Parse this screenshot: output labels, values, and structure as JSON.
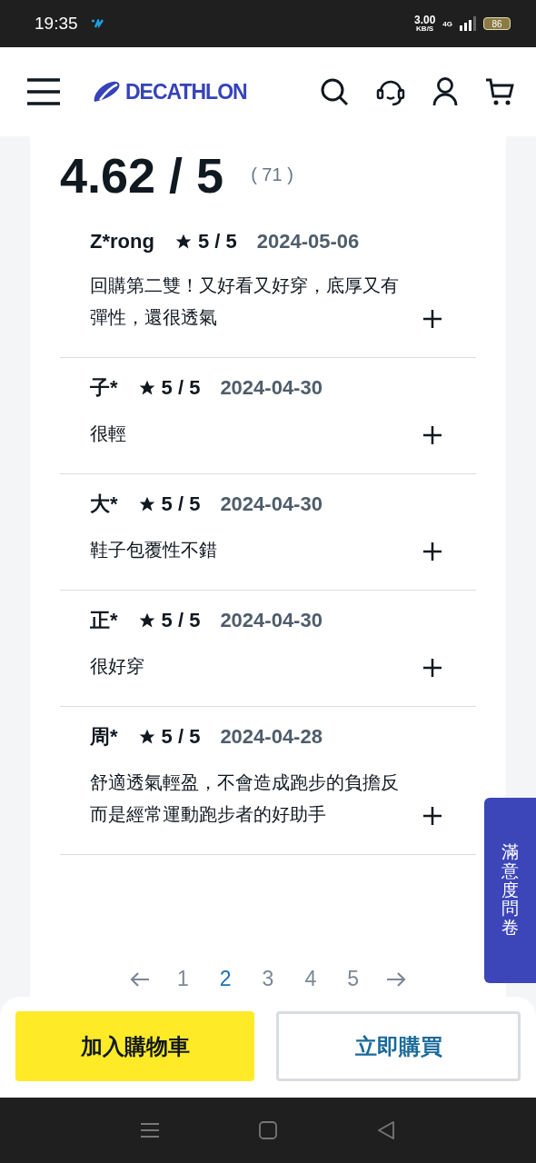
{
  "status_bar": {
    "time": "19:35",
    "net_speed": "3.00",
    "net_unit": "KB/S",
    "network": "4G",
    "battery": "86"
  },
  "header": {
    "logo": "DECATHLON"
  },
  "rating": {
    "score": "4.62 / 5",
    "count": "( 71 )"
  },
  "reviews": [
    {
      "author": "Z*rong",
      "rating": "5 / 5",
      "date": "2024-05-06",
      "text": "回購第二雙！又好看又好穿，底厚又有彈性，還很透氣"
    },
    {
      "author": "子*",
      "rating": "5 / 5",
      "date": "2024-04-30",
      "text": "很輕"
    },
    {
      "author": "大*",
      "rating": "5 / 5",
      "date": "2024-04-30",
      "text": "鞋子包覆性不錯"
    },
    {
      "author": "正*",
      "rating": "5 / 5",
      "date": "2024-04-30",
      "text": "很好穿"
    },
    {
      "author": "周*",
      "rating": "5 / 5",
      "date": "2024-04-28",
      "text": "舒適透氣輕盈，不會造成跑步的負擔反而是經常運動跑步者的好助手"
    }
  ],
  "pagination": [
    {
      "label": "1",
      "selected": false
    },
    {
      "label": "2",
      "selected": true
    },
    {
      "label": "3",
      "selected": false
    },
    {
      "label": "4",
      "selected": false
    },
    {
      "label": "5",
      "selected": false
    }
  ],
  "survey_tab": "滿意度問卷",
  "buttons": [
    {
      "label": "加入購物車",
      "kind": "primary"
    },
    {
      "label": "立即購買",
      "kind": "secondary"
    }
  ]
}
